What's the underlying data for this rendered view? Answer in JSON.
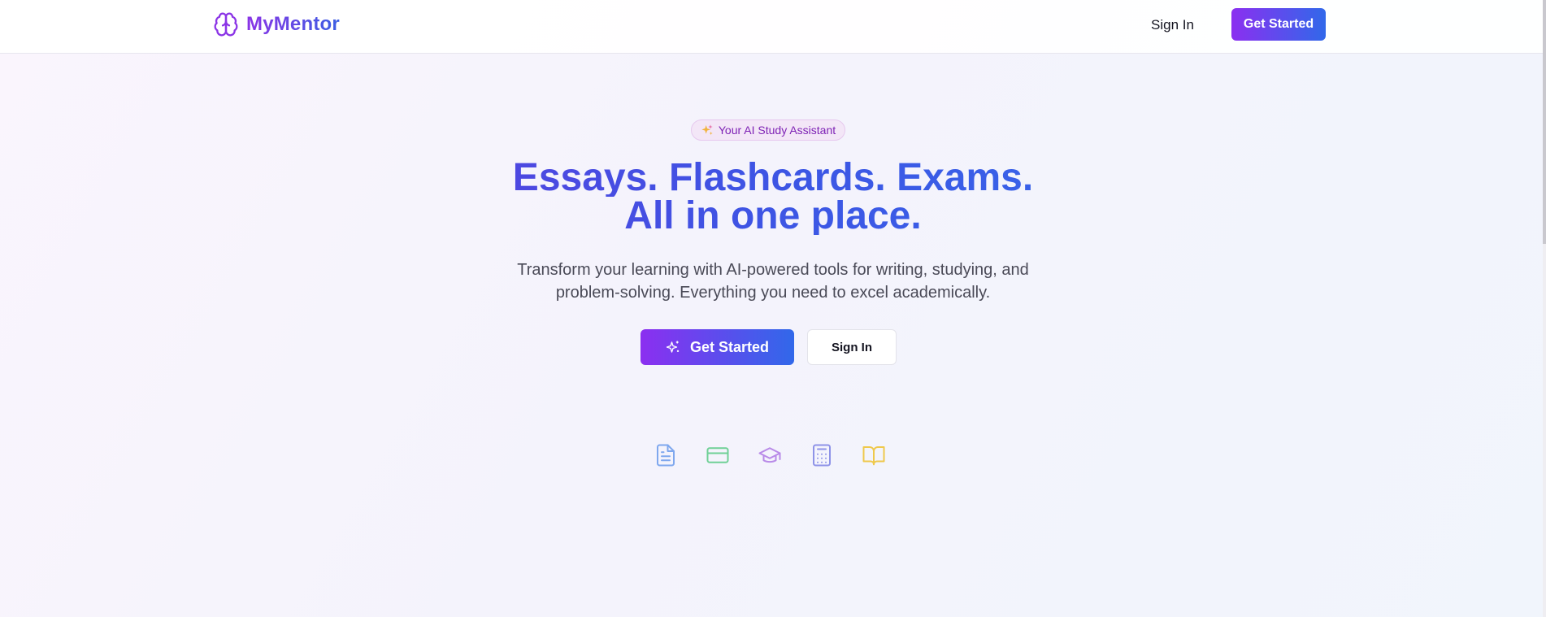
{
  "brand": {
    "name": "MyMentor",
    "icon": "brain-icon",
    "gradient": [
      "#8b34e6",
      "#3b5fe3"
    ]
  },
  "nav": {
    "sign_in": "Sign In",
    "get_started": "Get Started"
  },
  "hero": {
    "badge": {
      "icon": "sparkles-icon",
      "text": "Your AI Study Assistant"
    },
    "title_line1": "Essays. Flashcards. Exams.",
    "title_line2": "All in one place.",
    "subtitle_line1": "Transform your learning with AI-powered tools for writing, studying, and",
    "subtitle_line2": "problem-solving. Everything you need to excel academically.",
    "primary_cta": {
      "icon": "sparkles-icon",
      "label": "Get Started"
    },
    "secondary_cta": {
      "label": "Sign In"
    }
  },
  "features": [
    {
      "icon": "document-icon",
      "color": "#7ea7ee"
    },
    {
      "icon": "credit-card-icon",
      "color": "#6fd096"
    },
    {
      "icon": "graduation-cap-icon",
      "color": "#b98ae8"
    },
    {
      "icon": "calculator-icon",
      "color": "#8e93e8"
    },
    {
      "icon": "book-open-icon",
      "color": "#efc94c"
    }
  ],
  "colors": {
    "accent_start": "#8b2ff0",
    "accent_end": "#3168ea",
    "badge_text": "#7e22b5",
    "badge_bg": "#f3e6f7"
  }
}
